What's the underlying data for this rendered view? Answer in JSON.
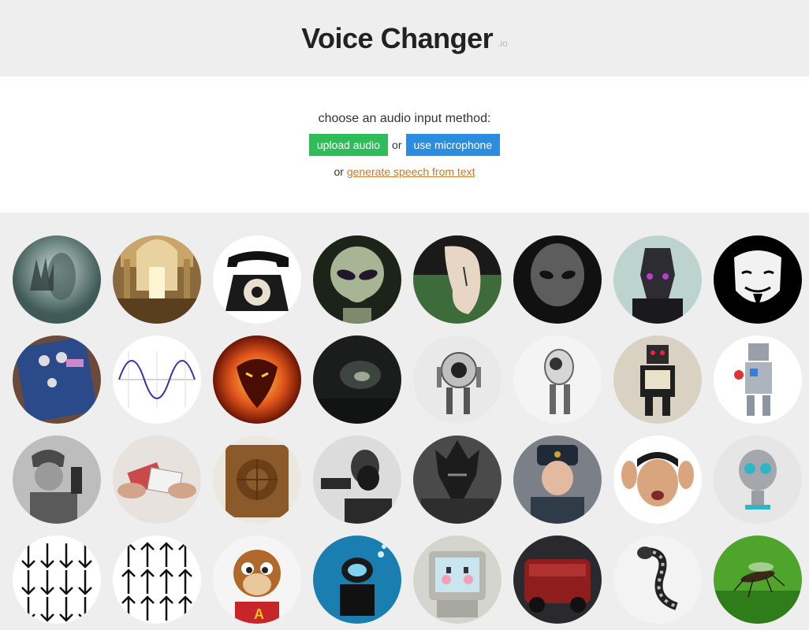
{
  "header": {
    "title": "Voice Changer",
    "suffix": ".io"
  },
  "input": {
    "prompt": "choose an audio input method:",
    "upload_label": "upload audio",
    "or_label": "or",
    "mic_label": "use microphone",
    "alt_prefix": "or",
    "tts_link": "generate speech from text"
  },
  "voices": [
    "ghost",
    "cathedral",
    "telephone",
    "alien",
    "melting-clock",
    "dark-alien",
    "dark-robot",
    "anonymous-mask",
    "guitar-pedal",
    "sine-wave",
    "balrog",
    "cave",
    "robot-eye-1",
    "robot-eye-2",
    "toy-robot-tv",
    "toy-robot-silver",
    "radio-soldier",
    "card-shuffle",
    "wooden-speaker",
    "bell-telephone",
    "sauron",
    "russian-officer",
    "wtf-face",
    "round-robot",
    "arrows-down",
    "arrows-up",
    "chipmunk",
    "diver",
    "retro-computer",
    "red-machine",
    "snake-robot",
    "mosquito"
  ]
}
